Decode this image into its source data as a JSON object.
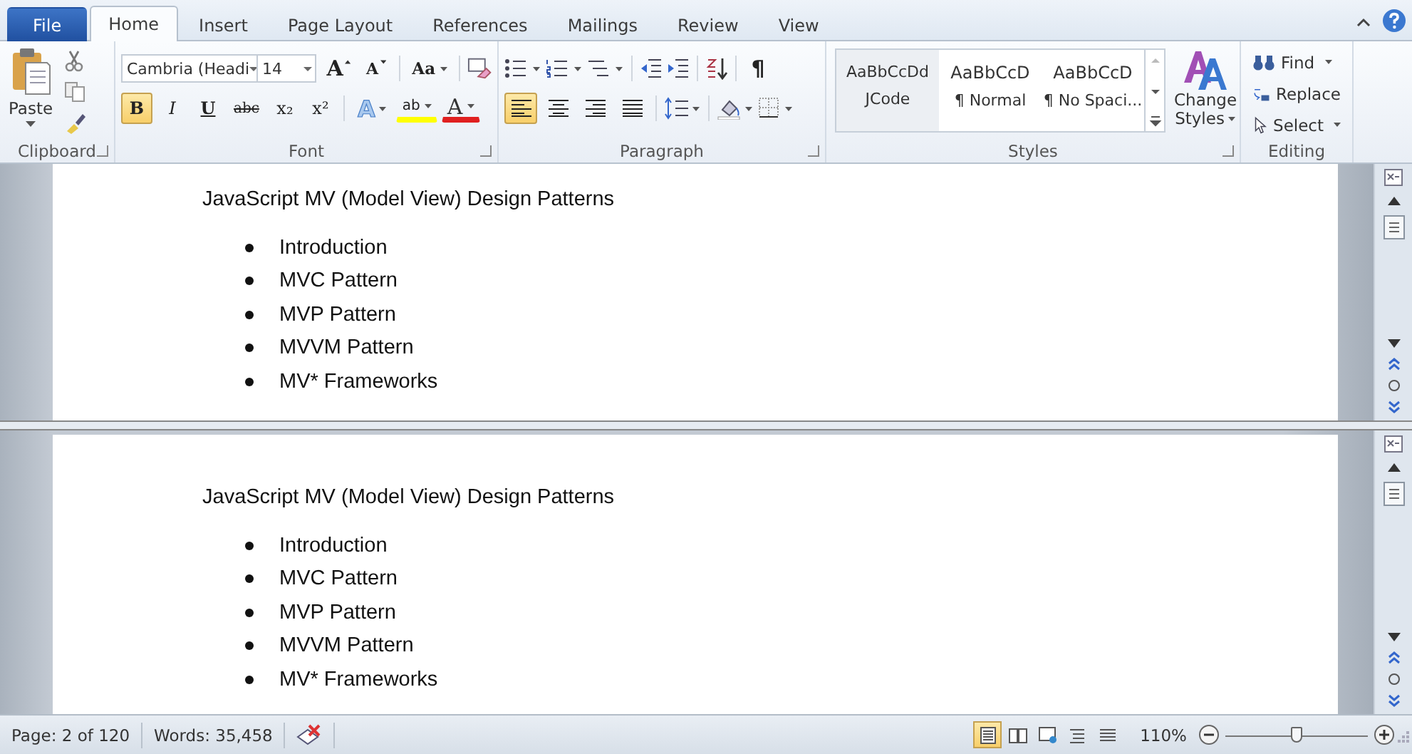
{
  "tabs": [
    {
      "label": "File",
      "kind": "file",
      "selected": false
    },
    {
      "label": "Home",
      "kind": "tab",
      "selected": true
    },
    {
      "label": "Insert",
      "kind": "tab",
      "selected": false
    },
    {
      "label": "Page Layout",
      "kind": "tab",
      "selected": false
    },
    {
      "label": "References",
      "kind": "tab",
      "selected": false
    },
    {
      "label": "Mailings",
      "kind": "tab",
      "selected": false
    },
    {
      "label": "Review",
      "kind": "tab",
      "selected": false
    },
    {
      "label": "View",
      "kind": "tab",
      "selected": false
    }
  ],
  "clipboard": {
    "paste": "Paste",
    "label": "Clipboard"
  },
  "font": {
    "label": "Font",
    "font_name": "Cambria (Headi",
    "font_size": "14",
    "grow": "A",
    "shrink": "A",
    "change_case": "Aa",
    "format_buttons": [
      {
        "label": "B",
        "kind": "bold",
        "selected": true
      },
      {
        "label": "I",
        "kind": "italic",
        "selected": false
      },
      {
        "label": "U",
        "kind": "underline",
        "selected": false
      },
      {
        "label": "abc",
        "kind": "strike",
        "selected": false
      },
      {
        "label": "x₂",
        "kind": "sub",
        "selected": false
      },
      {
        "label": "x²",
        "kind": "sup",
        "selected": false
      }
    ],
    "text_effects": "A",
    "highlight": "ab",
    "font_color": "A"
  },
  "paragraph": {
    "label": "Paragraph",
    "pilcrow": "¶",
    "alignment_buttons": [
      {
        "kind": "left",
        "selected": true
      },
      {
        "kind": "center",
        "selected": false
      },
      {
        "kind": "right",
        "selected": false
      },
      {
        "kind": "justify",
        "selected": false
      }
    ]
  },
  "styles": {
    "label": "Styles",
    "change_styles": [
      "Change",
      "Styles"
    ],
    "gallery": [
      {
        "preview": "AaBbCcDd",
        "name": "JCode",
        "selected": true
      },
      {
        "preview": "AaBbCcD",
        "name": "¶ Normal",
        "selected": false
      },
      {
        "preview": "AaBbCcD",
        "name": "¶ No Spaci...",
        "selected": false
      }
    ]
  },
  "editing": {
    "label": "Editing",
    "find": "Find",
    "replace": "Replace",
    "select": "Select"
  },
  "panes": [
    {
      "title": "JavaScript MV (Model View) Design Patterns",
      "items": [
        "Introduction",
        "MVC Pattern",
        "MVP Pattern",
        "MVVM Pattern",
        "MV* Frameworks"
      ]
    },
    {
      "title": "JavaScript MV (Model View) Design Patterns",
      "items": [
        "Introduction",
        "MVC Pattern",
        "MVP Pattern",
        "MVVM Pattern",
        "MV* Frameworks"
      ]
    }
  ],
  "status_bar": {
    "page": "Page: 2 of 120",
    "words": "Words: 35,458",
    "views": [
      {
        "kind": "print",
        "selected": true
      },
      {
        "kind": "reading",
        "selected": false
      },
      {
        "kind": "web",
        "selected": false
      },
      {
        "kind": "outline",
        "selected": false
      },
      {
        "kind": "draft",
        "selected": false
      }
    ],
    "zoom": "110%",
    "zoom_slider": {
      "level": 0.5
    }
  }
}
